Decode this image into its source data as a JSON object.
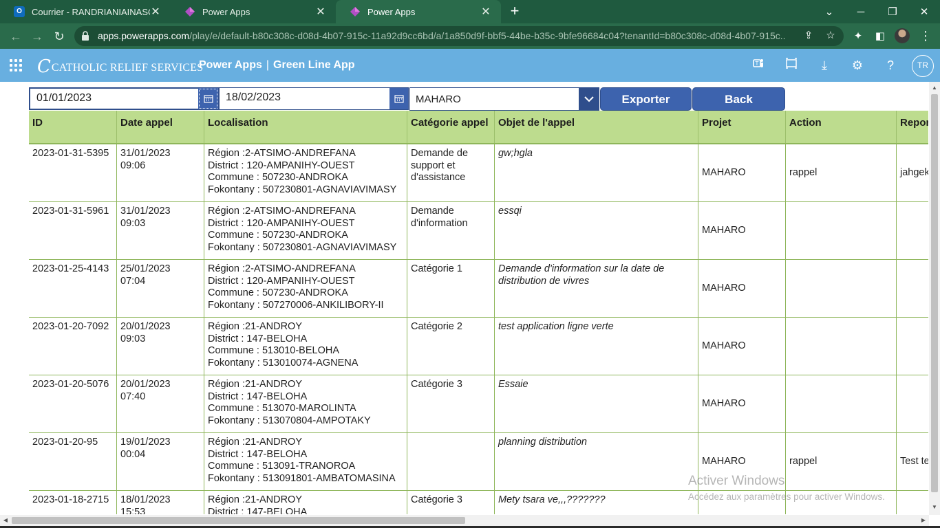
{
  "browser": {
    "tabs": [
      {
        "title": "Courrier - RANDRIANIAINASOA,",
        "icon": "outlook-icon",
        "active": false
      },
      {
        "title": "Power Apps",
        "icon": "powerapps-icon",
        "active": false
      },
      {
        "title": "Power Apps",
        "icon": "powerapps-icon",
        "active": true
      }
    ],
    "url_host": "apps.powerapps.com",
    "url_path": "/play/e/default-b80c308c-d08d-4b07-915c-11a92d9cc6bd/a/1a850d9f-bbf5-44be-b35c-9bfe96684c04?tenantId=b80c308c-d08d-4b07-915c..."
  },
  "header": {
    "logo_text": "CATHOLIC RELIEF SERVICES",
    "brand": "Power Apps",
    "separator": "|",
    "app_name": "Green Line App",
    "avatar_initials": "TR",
    "bg_color": "#68afe0"
  },
  "filters": {
    "start_date": "01/01/2023",
    "end_date": "18/02/2023",
    "project": "MAHARO",
    "export_label": "Exporter",
    "back_label": "Back"
  },
  "table": {
    "headers": [
      "ID",
      "Date appel",
      "Localisation",
      "Catégorie appel",
      "Objet de l'appel",
      "Projet",
      "Action",
      "Repor"
    ],
    "rows": [
      {
        "id": "2023-01-31-5395",
        "date": "31/01/2023",
        "time": "09:06",
        "loc": [
          "Région :2-ATSIMO-ANDREFANA",
          "District : 120-AMPANIHY-OUEST",
          "Commune : 507230-ANDROKA",
          "Fokontany : 507230801-AGNAVIAVIMASY"
        ],
        "categorie": "Demande de support et d'assistance",
        "objet": "gw;hgla",
        "projet": "MAHARO",
        "action": "rappel",
        "report": "jahgek"
      },
      {
        "id": "2023-01-31-5961",
        "date": "31/01/2023",
        "time": "09:03",
        "loc": [
          "Région :2-ATSIMO-ANDREFANA",
          "District : 120-AMPANIHY-OUEST",
          "Commune : 507230-ANDROKA",
          "Fokontany : 507230801-AGNAVIAVIMASY"
        ],
        "categorie": "Demande d'information",
        "objet": "essqi",
        "projet": "MAHARO",
        "action": "",
        "report": ""
      },
      {
        "id": "2023-01-25-4143",
        "date": "25/01/2023",
        "time": "07:04",
        "loc": [
          "Région :2-ATSIMO-ANDREFANA",
          "District : 120-AMPANIHY-OUEST",
          "Commune : 507230-ANDROKA",
          "Fokontany : 507270006-ANKILIBORY-II"
        ],
        "categorie": "Catégorie 1",
        "objet": "Demande d'information sur la date de distribution de vivres",
        "projet": "MAHARO",
        "action": "",
        "report": ""
      },
      {
        "id": "2023-01-20-7092",
        "date": "20/01/2023",
        "time": "09:03",
        "loc": [
          "Région :21-ANDROY",
          "District : 147-BELOHA",
          "Commune : 513010-BELOHA",
          "Fokontany : 513010074-AGNENA"
        ],
        "categorie": "Catégorie 2",
        "objet": "test application ligne verte",
        "projet": "MAHARO",
        "action": "",
        "report": ""
      },
      {
        "id": "2023-01-20-5076",
        "date": "20/01/2023",
        "time": "07:40",
        "loc": [
          "Région :21-ANDROY",
          "District : 147-BELOHA",
          "Commune : 513070-MAROLINTA",
          "Fokontany : 513070804-AMPOTAKY"
        ],
        "categorie": "Catégorie 3",
        "objet": "Essaie",
        "projet": "MAHARO",
        "action": "",
        "report": ""
      },
      {
        "id": "2023-01-20-95",
        "date": "19/01/2023",
        "time": "00:04",
        "loc": [
          "Région :21-ANDROY",
          "District : 147-BELOHA",
          "Commune : 513091-TRANOROA",
          "Fokontany : 513091801-AMBATOMASINA"
        ],
        "categorie": "",
        "objet": "planning distribution",
        "projet": "MAHARO",
        "action": "rappel",
        "report": "Test te"
      },
      {
        "id": "2023-01-18-2715",
        "date": "18/01/2023",
        "time": "15:53",
        "loc": [
          "Région :21-ANDROY",
          "District : 147-BELOHA",
          "",
          ""
        ],
        "categorie": "Catégorie 3",
        "objet": "Mety tsara ve,,,???????",
        "projet": "",
        "action": "",
        "report": ""
      }
    ]
  },
  "watermark": {
    "line1": "Activer Windows",
    "line2": "Accédez aux paramètres pour activer Windows."
  },
  "colors": {
    "table_header": "#bddc8e",
    "table_border": "#8eb65a",
    "button": "#3d63ae",
    "browser_chrome": "#2a6b4b"
  }
}
